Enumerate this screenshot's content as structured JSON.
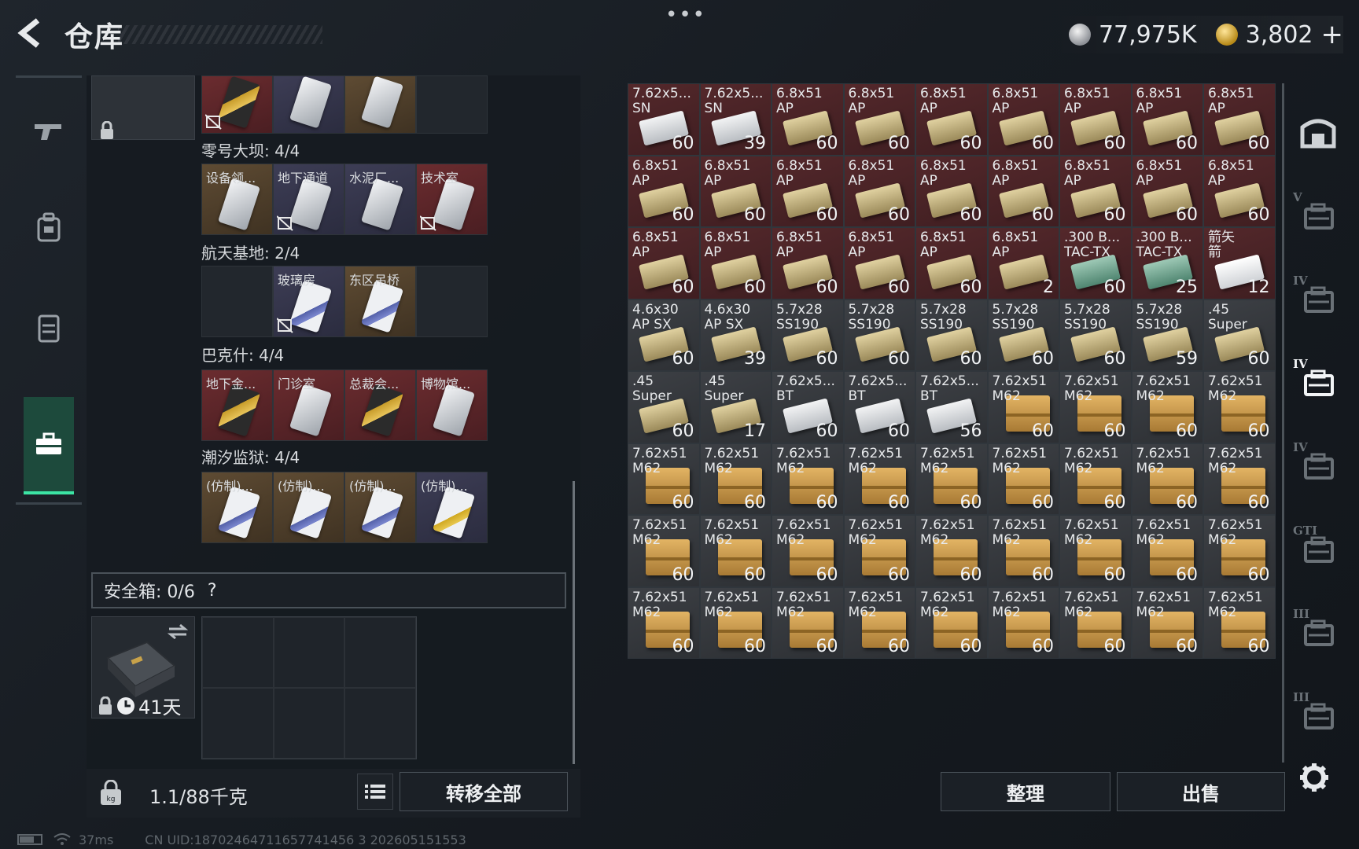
{
  "header": {
    "title": "仓库",
    "dots": "•••",
    "silver_amount": "77,975K",
    "gold_amount": "3,802",
    "plus": "+"
  },
  "left_panel": {
    "top_slots": [
      {
        "label": "",
        "rarity": "red",
        "card": "gold",
        "broken": true
      },
      {
        "label": "",
        "rarity": "purple",
        "card": "white",
        "broken": false
      },
      {
        "label": "",
        "rarity": "gold",
        "card": "white",
        "broken": false
      },
      {
        "label": "",
        "rarity": "empty",
        "card": "",
        "broken": false
      }
    ],
    "sections": [
      {
        "title": "零号大坝: 4/4",
        "slots": [
          {
            "label": "设备领...",
            "rarity": "gold",
            "card": "white",
            "broken": false
          },
          {
            "label": "地下通道",
            "rarity": "purple",
            "card": "white",
            "broken": true
          },
          {
            "label": "水泥厂...",
            "rarity": "purple",
            "card": "white",
            "broken": false
          },
          {
            "label": "技术室",
            "rarity": "red",
            "card": "white",
            "broken": true
          }
        ]
      },
      {
        "title": "航天基地: 2/4",
        "slots": [
          {
            "label": "",
            "rarity": "empty",
            "card": "",
            "broken": false
          },
          {
            "label": "玻璃房",
            "rarity": "purple",
            "card": "blue",
            "broken": true
          },
          {
            "label": "东区吊桥",
            "rarity": "gold",
            "card": "blue",
            "broken": false
          },
          {
            "label": "",
            "rarity": "empty",
            "card": "",
            "broken": false
          }
        ]
      },
      {
        "title": "巴克什: 4/4",
        "slots": [
          {
            "label": "地下金...",
            "rarity": "red",
            "card": "gold",
            "broken": false
          },
          {
            "label": "门诊室",
            "rarity": "red",
            "card": "white",
            "broken": false
          },
          {
            "label": "总裁会...",
            "rarity": "red",
            "card": "gold",
            "broken": false
          },
          {
            "label": "博物馆...",
            "rarity": "red",
            "card": "white",
            "broken": false
          }
        ]
      },
      {
        "title": "潮汐监狱: 4/4",
        "slots": [
          {
            "label": "(仿制)...",
            "rarity": "gold",
            "card": "blue",
            "broken": false
          },
          {
            "label": "(仿制)...",
            "rarity": "gold",
            "card": "blue",
            "broken": false
          },
          {
            "label": "(仿制)...",
            "rarity": "gold",
            "card": "blue",
            "broken": false
          },
          {
            "label": "(仿制)...",
            "rarity": "purple",
            "card": "yellowstripe",
            "broken": false
          }
        ]
      }
    ],
    "safebox_title": "安全箱: 0/6",
    "safebox_help": "?",
    "safebox_days": "41天",
    "weight": "1.1/88千克",
    "transfer_all": "转移全部"
  },
  "ammo_grid": [
    {
      "name": "7.62x5...",
      "sub": "SN",
      "count": "60",
      "rarity": "red",
      "box": "silver"
    },
    {
      "name": "7.62x5...",
      "sub": "SN",
      "count": "39",
      "rarity": "red",
      "box": "silver"
    },
    {
      "name": "6.8x51",
      "sub": "AP",
      "count": "60",
      "rarity": "red",
      "box": "tan"
    },
    {
      "name": "6.8x51",
      "sub": "AP",
      "count": "60",
      "rarity": "red",
      "box": "tan"
    },
    {
      "name": "6.8x51",
      "sub": "AP",
      "count": "60",
      "rarity": "red",
      "box": "tan"
    },
    {
      "name": "6.8x51",
      "sub": "AP",
      "count": "60",
      "rarity": "red",
      "box": "tan"
    },
    {
      "name": "6.8x51",
      "sub": "AP",
      "count": "60",
      "rarity": "red",
      "box": "tan"
    },
    {
      "name": "6.8x51",
      "sub": "AP",
      "count": "60",
      "rarity": "red",
      "box": "tan"
    },
    {
      "name": "6.8x51",
      "sub": "AP",
      "count": "60",
      "rarity": "red",
      "box": "tan"
    },
    {
      "name": "6.8x51",
      "sub": "AP",
      "count": "60",
      "rarity": "red",
      "box": "tan"
    },
    {
      "name": "6.8x51",
      "sub": "AP",
      "count": "60",
      "rarity": "red",
      "box": "tan"
    },
    {
      "name": "6.8x51",
      "sub": "AP",
      "count": "60",
      "rarity": "red",
      "box": "tan"
    },
    {
      "name": "6.8x51",
      "sub": "AP",
      "count": "60",
      "rarity": "red",
      "box": "tan"
    },
    {
      "name": "6.8x51",
      "sub": "AP",
      "count": "60",
      "rarity": "red",
      "box": "tan"
    },
    {
      "name": "6.8x51",
      "sub": "AP",
      "count": "60",
      "rarity": "red",
      "box": "tan"
    },
    {
      "name": "6.8x51",
      "sub": "AP",
      "count": "60",
      "rarity": "red",
      "box": "tan"
    },
    {
      "name": "6.8x51",
      "sub": "AP",
      "count": "60",
      "rarity": "red",
      "box": "tan"
    },
    {
      "name": "6.8x51",
      "sub": "AP",
      "count": "60",
      "rarity": "red",
      "box": "tan"
    },
    {
      "name": "6.8x51",
      "sub": "AP",
      "count": "60",
      "rarity": "red",
      "box": "tan"
    },
    {
      "name": "6.8x51",
      "sub": "AP",
      "count": "60",
      "rarity": "red",
      "box": "tan"
    },
    {
      "name": "6.8x51",
      "sub": "AP",
      "count": "60",
      "rarity": "red",
      "box": "tan"
    },
    {
      "name": "6.8x51",
      "sub": "AP",
      "count": "60",
      "rarity": "red",
      "box": "tan"
    },
    {
      "name": "6.8x51",
      "sub": "AP",
      "count": "60",
      "rarity": "red",
      "box": "tan"
    },
    {
      "name": "6.8x51",
      "sub": "AP",
      "count": "2",
      "rarity": "red",
      "box": "tan"
    },
    {
      "name": ".300 B...",
      "sub": "TAC-TX",
      "count": "60",
      "rarity": "red",
      "box": "green"
    },
    {
      "name": ".300 B...",
      "sub": "TAC-TX",
      "count": "25",
      "rarity": "red",
      "box": "green"
    },
    {
      "name": "箭矢",
      "sub": "箭",
      "count": "12",
      "rarity": "red",
      "box": "white"
    },
    {
      "name": "4.6x30",
      "sub": "AP SX",
      "count": "60",
      "rarity": "grey",
      "box": "tan"
    },
    {
      "name": "4.6x30",
      "sub": "AP SX",
      "count": "39",
      "rarity": "grey",
      "box": "tan"
    },
    {
      "name": "5.7x28",
      "sub": "SS190",
      "count": "60",
      "rarity": "grey",
      "box": "tan"
    },
    {
      "name": "5.7x28",
      "sub": "SS190",
      "count": "60",
      "rarity": "grey",
      "box": "tan"
    },
    {
      "name": "5.7x28",
      "sub": "SS190",
      "count": "60",
      "rarity": "grey",
      "box": "tan"
    },
    {
      "name": "5.7x28",
      "sub": "SS190",
      "count": "60",
      "rarity": "grey",
      "box": "tan"
    },
    {
      "name": "5.7x28",
      "sub": "SS190",
      "count": "60",
      "rarity": "grey",
      "box": "tan"
    },
    {
      "name": "5.7x28",
      "sub": "SS190",
      "count": "59",
      "rarity": "grey",
      "box": "tan"
    },
    {
      "name": ".45",
      "sub": "Super",
      "count": "60",
      "rarity": "grey",
      "box": "tan"
    },
    {
      "name": ".45",
      "sub": "Super",
      "count": "60",
      "rarity": "grey",
      "box": "tan"
    },
    {
      "name": ".45",
      "sub": "Super",
      "count": "17",
      "rarity": "grey",
      "box": "tan"
    },
    {
      "name": "7.62x5...",
      "sub": "BT",
      "count": "60",
      "rarity": "grey",
      "box": "silver"
    },
    {
      "name": "7.62x5...",
      "sub": "BT",
      "count": "60",
      "rarity": "grey",
      "box": "silver"
    },
    {
      "name": "7.62x5...",
      "sub": "BT",
      "count": "56",
      "rarity": "grey",
      "box": "silver"
    },
    {
      "name": "7.62x51",
      "sub": "M62",
      "count": "60",
      "rarity": "grey",
      "box": "cardboard"
    },
    {
      "name": "7.62x51",
      "sub": "M62",
      "count": "60",
      "rarity": "grey",
      "box": "cardboard"
    },
    {
      "name": "7.62x51",
      "sub": "M62",
      "count": "60",
      "rarity": "grey",
      "box": "cardboard"
    },
    {
      "name": "7.62x51",
      "sub": "M62",
      "count": "60",
      "rarity": "grey",
      "box": "cardboard"
    },
    {
      "name": "7.62x51",
      "sub": "M62",
      "count": "60",
      "rarity": "grey",
      "box": "cardboard"
    },
    {
      "name": "7.62x51",
      "sub": "M62",
      "count": "60",
      "rarity": "grey",
      "box": "cardboard"
    },
    {
      "name": "7.62x51",
      "sub": "M62",
      "count": "60",
      "rarity": "grey",
      "box": "cardboard"
    },
    {
      "name": "7.62x51",
      "sub": "M62",
      "count": "60",
      "rarity": "grey",
      "box": "cardboard"
    },
    {
      "name": "7.62x51",
      "sub": "M62",
      "count": "60",
      "rarity": "grey",
      "box": "cardboard"
    },
    {
      "name": "7.62x51",
      "sub": "M62",
      "count": "60",
      "rarity": "grey",
      "box": "cardboard"
    },
    {
      "name": "7.62x51",
      "sub": "M62",
      "count": "60",
      "rarity": "grey",
      "box": "cardboard"
    },
    {
      "name": "7.62x51",
      "sub": "M62",
      "count": "60",
      "rarity": "grey",
      "box": "cardboard"
    },
    {
      "name": "7.62x51",
      "sub": "M62",
      "count": "60",
      "rarity": "grey",
      "box": "cardboard"
    },
    {
      "name": "7.62x51",
      "sub": "M62",
      "count": "60",
      "rarity": "grey",
      "box": "cardboard"
    },
    {
      "name": "7.62x51",
      "sub": "M62",
      "count": "60",
      "rarity": "grey",
      "box": "cardboard"
    },
    {
      "name": "7.62x51",
      "sub": "M62",
      "count": "60",
      "rarity": "grey",
      "box": "cardboard"
    },
    {
      "name": "7.62x51",
      "sub": "M62",
      "count": "60",
      "rarity": "grey",
      "box": "cardboard"
    },
    {
      "name": "7.62x51",
      "sub": "M62",
      "count": "60",
      "rarity": "grey",
      "box": "cardboard"
    },
    {
      "name": "7.62x51",
      "sub": "M62",
      "count": "60",
      "rarity": "grey",
      "box": "cardboard"
    },
    {
      "name": "7.62x51",
      "sub": "M62",
      "count": "60",
      "rarity": "grey",
      "box": "cardboard"
    },
    {
      "name": "7.62x51",
      "sub": "M62",
      "count": "60",
      "rarity": "grey",
      "box": "cardboard"
    },
    {
      "name": "7.62x51",
      "sub": "M62",
      "count": "60",
      "rarity": "grey",
      "box": "cardboard"
    },
    {
      "name": "7.62x51",
      "sub": "M62",
      "count": "60",
      "rarity": "grey",
      "box": "cardboard"
    },
    {
      "name": "7.62x51",
      "sub": "M62",
      "count": "60",
      "rarity": "grey",
      "box": "cardboard"
    },
    {
      "name": "7.62x51",
      "sub": "M62",
      "count": "60",
      "rarity": "grey",
      "box": "cardboard"
    },
    {
      "name": "7.62x51",
      "sub": "M62",
      "count": "60",
      "rarity": "grey",
      "box": "cardboard"
    },
    {
      "name": "7.62x51",
      "sub": "M62",
      "count": "60",
      "rarity": "grey",
      "box": "cardboard"
    },
    {
      "name": "7.62x51",
      "sub": "M62",
      "count": "60",
      "rarity": "grey",
      "box": "cardboard"
    },
    {
      "name": "7.62x51",
      "sub": "M62",
      "count": "60",
      "rarity": "grey",
      "box": "cardboard"
    },
    {
      "name": "7.62x51",
      "sub": "M62",
      "count": "60",
      "rarity": "grey",
      "box": "cardboard"
    },
    {
      "name": "7.62x51",
      "sub": "M62",
      "count": "60",
      "rarity": "grey",
      "box": "cardboard"
    }
  ],
  "right_panel": {
    "sort": "整理",
    "sell": "出售"
  },
  "right_tabs": [
    {
      "icon": "vault-icon",
      "tier": ""
    },
    {
      "icon": "weapon-case-icon",
      "tier": "V"
    },
    {
      "icon": "tool-case-icon",
      "tier": "IV"
    },
    {
      "icon": "ammo-case-icon",
      "tier": "IV"
    },
    {
      "icon": "card-case-icon",
      "tier": "IV"
    },
    {
      "icon": "gti-case-icon",
      "tier": "GTI"
    },
    {
      "icon": "rifle-rack-icon",
      "tier": "III"
    },
    {
      "icon": "rifle-rack-icon",
      "tier": "III"
    }
  ],
  "status": {
    "ping": "37ms",
    "uid": "CN UID:18702464711657741456 3 202605151553"
  },
  "colors": {
    "accent_green": "#3ce4a4",
    "rarity_red": "#54282b",
    "rarity_gold": "#5e4b33",
    "rarity_purple": "#3d3d55"
  }
}
